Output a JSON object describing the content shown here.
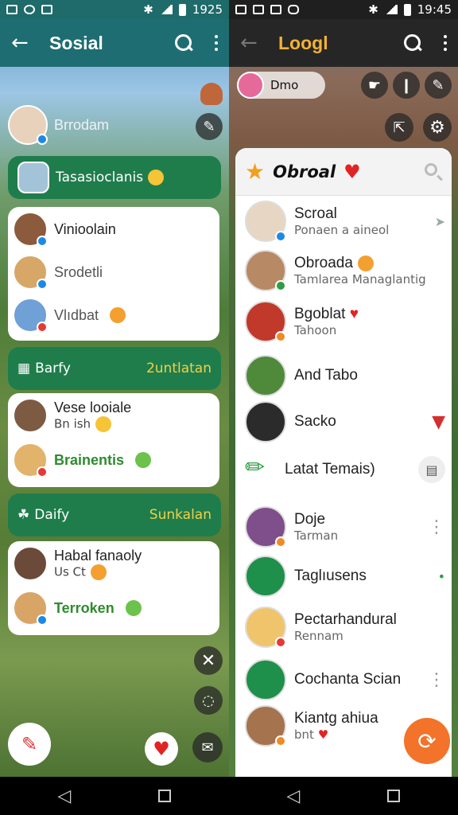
{
  "left": {
    "status": {
      "time": "1925"
    },
    "appbar": {
      "title": "Sosial",
      "back_icon": "arrow-left-icon",
      "search_icon": "search-icon",
      "menu_icon": "kebab-icon"
    },
    "profile": {
      "name": "Brrodam"
    },
    "groups": [
      {
        "header": "Tasasioclanis",
        "header_right": "",
        "items": [
          {
            "name": "Vinioolain",
            "sub": "",
            "badge": "b-blue"
          },
          {
            "name": "Srodetli",
            "sub": "",
            "badge": "b-blue"
          },
          {
            "name": "Vlıdbat",
            "sub": "",
            "badge": "b-red"
          }
        ]
      },
      {
        "header": "Barfy",
        "header_right": "2untlatan",
        "items": [
          {
            "name": "Vese looiale",
            "sub": "Bn ish",
            "badge": ""
          },
          {
            "name": "Brainentis",
            "sub": "",
            "badge": "b-red"
          }
        ]
      },
      {
        "header": "Daify",
        "header_right": "Sunkalan",
        "items": [
          {
            "name": "Habal fanaoly",
            "sub": "Us Ct",
            "badge": ""
          },
          {
            "name": "Terroken",
            "sub": "",
            "badge": "b-blue"
          }
        ]
      }
    ]
  },
  "right": {
    "status": {
      "time": "19:45"
    },
    "appbar": {
      "title": "Loogl"
    },
    "top_user": {
      "name": "Dmo"
    },
    "list_title": "Obroal",
    "contacts": [
      {
        "name": "Scroal",
        "sub": "Ponaen a aineol",
        "avatar": "#e8d6c4",
        "badge": "b-blue"
      },
      {
        "name": "Obroada",
        "sub": "Tamlarea Managlantig",
        "avatar": "#b88965",
        "badge": "b-green"
      },
      {
        "name": "Bgoblat",
        "sub": "Tahoon",
        "avatar": "#c0392b",
        "badge": "b-orange"
      },
      {
        "name": "And Tabo",
        "sub": "",
        "avatar": "#4f8a3a",
        "badge": ""
      },
      {
        "name": "Sacko",
        "sub": "",
        "avatar": "#2b2b2b",
        "badge": ""
      },
      {
        "name": "Latat Temais)",
        "sub": "",
        "avatar": "#ffffff",
        "badge": ""
      },
      {
        "name": "Doje",
        "sub": "Tarman",
        "avatar": "#7e4f8a",
        "badge": "b-orange"
      },
      {
        "name": "Taglıusens",
        "sub": "",
        "avatar": "#1f8f4c",
        "badge": ""
      },
      {
        "name": "Pectarhandural",
        "sub": "Rennam",
        "avatar": "#f0c46a",
        "badge": "b-red"
      },
      {
        "name": "Cochanta Scian",
        "sub": "",
        "avatar": "#1f8f4c",
        "badge": ""
      },
      {
        "name": "Kiantg ahiua",
        "sub": "bnt",
        "avatar": "#a5734e",
        "badge": "b-orange"
      }
    ]
  }
}
